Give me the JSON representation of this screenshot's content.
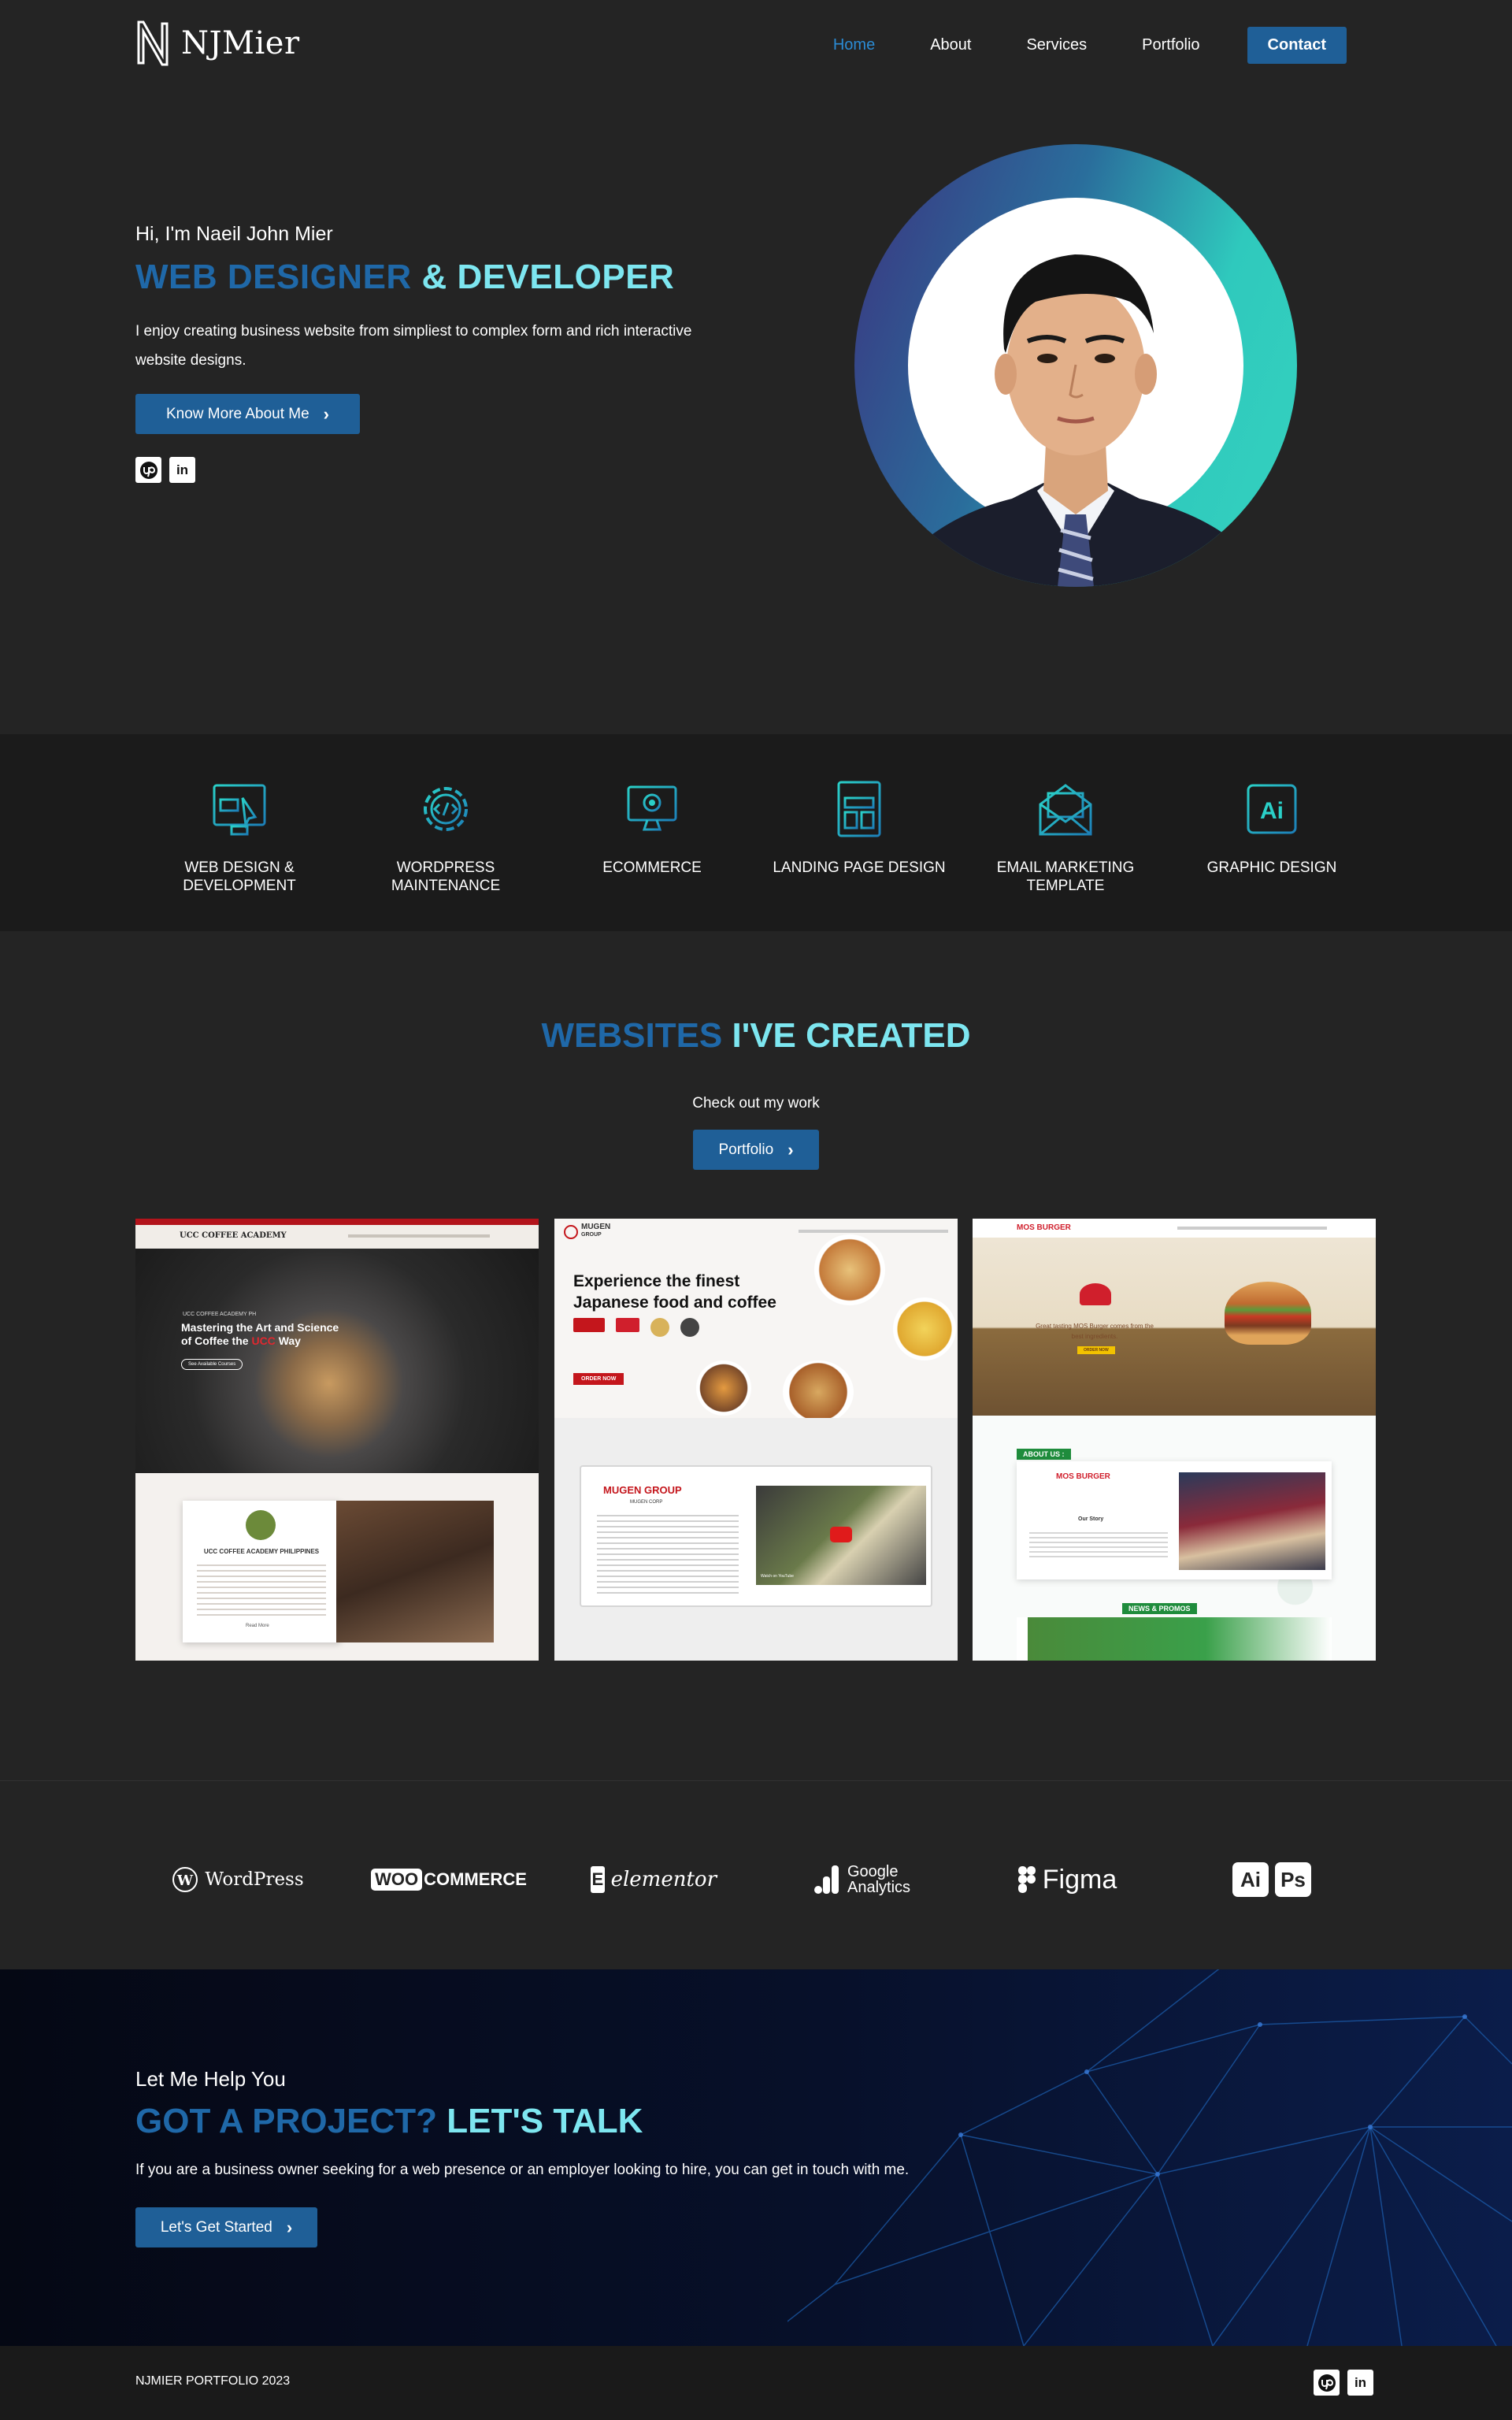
{
  "nav": {
    "logo_text": "NJMier",
    "items": [
      {
        "label": "Home",
        "active": true
      },
      {
        "label": "About",
        "active": false
      },
      {
        "label": "Services",
        "active": false
      },
      {
        "label": "Portfolio",
        "active": false
      }
    ],
    "contact_label": "Contact"
  },
  "hero": {
    "greeting": "Hi, I'm Naeil John Mier",
    "title_part1": "WEB DESIGNER",
    "title_part2": "& DEVELOPER",
    "description": "I enjoy creating business website from simpliest to complex form and rich interactive website designs.",
    "button_label": "Know More About Me",
    "social": [
      {
        "name": "upwork-icon"
      },
      {
        "name": "linkedin-icon",
        "glyph": "in"
      }
    ]
  },
  "services": [
    {
      "label": "WEB DESIGN & DEVELOPMENT",
      "icon": "web-design-icon"
    },
    {
      "label": "WORDPRESS MAINTENANCE",
      "icon": "gear-code-icon"
    },
    {
      "label": "ECOMMERCE",
      "icon": "ecommerce-monitor-icon"
    },
    {
      "label": "LANDING PAGE DESIGN",
      "icon": "landing-page-icon"
    },
    {
      "label": "EMAIL MARKETING TEMPLATE",
      "icon": "email-icon"
    },
    {
      "label": "GRAPHIC DESIGN",
      "icon": "illustrator-icon",
      "glyph": "Ai"
    }
  ],
  "websites": {
    "title_part1": "WEBSITES",
    "title_part2": "I'VE CREATED",
    "subtitle": "Check out my work",
    "button_label": "Portfolio",
    "projects": [
      {
        "site": "UCC COFFEE ACADEMY",
        "hero_small": "UCC COFFEE ACADEMY PH",
        "hero_heading_1": "Mastering the Art and Science",
        "hero_heading_2": "of Coffee the",
        "hero_heading_highlight": "UCC",
        "hero_heading_3": "Way",
        "hero_button": "See Available Courses",
        "section_title": "UCC COFFEE ACADEMY PHILIPPINES",
        "read_more": "Read More"
      },
      {
        "site": "MUGEN GROUP",
        "logo": "MUGEN",
        "logo_sub": "GROUP",
        "hero_heading_1": "Experience the finest",
        "hero_heading_2": "Japanese food and coffee",
        "hero_button": "ORDER NOW",
        "section_title": "MUGEN GROUP",
        "section_sub": "MUGEN CORP",
        "video_label": "Watch on YouTube"
      },
      {
        "site": "MOS BURGER",
        "logo": "MOS BURGER",
        "tagline_1": "Great tasting MOS Burger comes from the",
        "tagline_2": "best ingredients.",
        "hero_button": "ORDER NOW",
        "about_label": "ABOUT US :",
        "story_label": "Our Story",
        "news_label": "NEWS & PROMOS"
      }
    ]
  },
  "tools": [
    {
      "label": "WordPress",
      "icon": "wordpress-icon"
    },
    {
      "label": "WOO",
      "label2": "COMMERCE",
      "icon": "woocommerce-icon"
    },
    {
      "label": "elementor",
      "icon": "elementor-icon",
      "glyph": "E"
    },
    {
      "label": "Google",
      "label2": "Analytics",
      "icon": "google-analytics-icon"
    },
    {
      "label": "Figma",
      "icon": "figma-icon"
    },
    {
      "label": "Ai",
      "label2": "Ps",
      "icon": "adobe-icon"
    }
  ],
  "cta": {
    "subtitle": "Let Me Help You",
    "title_part1": "GOT A PROJECT?",
    "title_part2": "LET'S TALK",
    "description": "If you are a business owner seeking for a web presence or an employer looking to hire, you can get in touch with me.",
    "button_label": "Let's Get Started"
  },
  "footer": {
    "copyright": "NJMIER PORTFOLIO 2023",
    "social": [
      {
        "name": "upwork-icon"
      },
      {
        "name": "linkedin-icon",
        "glyph": "in"
      }
    ]
  },
  "colors": {
    "accent_blue": "#1f68a8",
    "accent_cyan": "#7de6f0",
    "button": "#1f5f97",
    "background": "#242424",
    "nav_active": "#2b8bd4"
  }
}
